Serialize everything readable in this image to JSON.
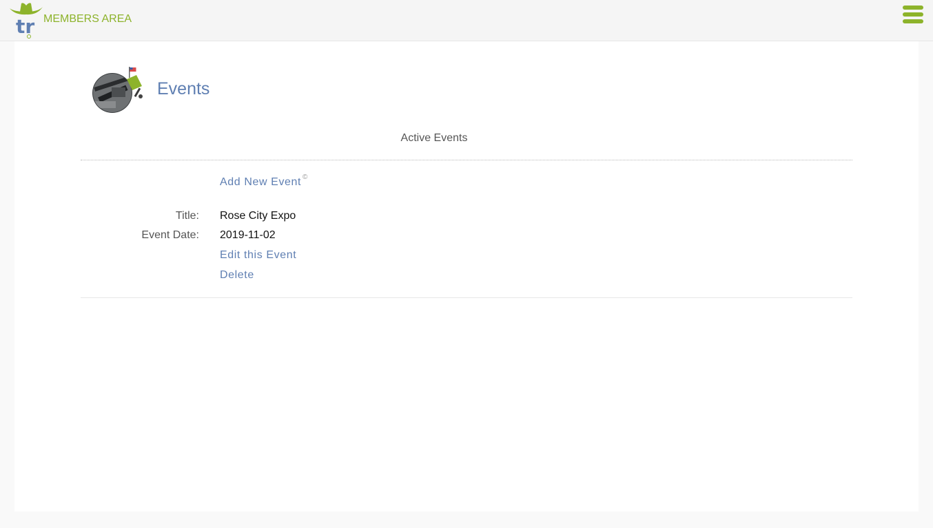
{
  "header": {
    "brand_text": "MEMBERS AREA",
    "logo_letters": "tr",
    "accent_color": "#8db32b",
    "logo_color": "#5f7fb2"
  },
  "page": {
    "title": "Events",
    "section_heading": "Active Events",
    "add_link": "Add New Event",
    "add_link_mark": "©"
  },
  "event": {
    "title_label": "Title:",
    "title_value": "Rose City Expo",
    "date_label": "Event Date:",
    "date_value": "2019-11-02",
    "edit_link": "Edit this Event",
    "delete_link": "Delete"
  },
  "icons": {
    "menu": "hamburger-menu-icon",
    "logo": "cowboy-hat-logo-icon",
    "page": "events-avatar-icon"
  }
}
